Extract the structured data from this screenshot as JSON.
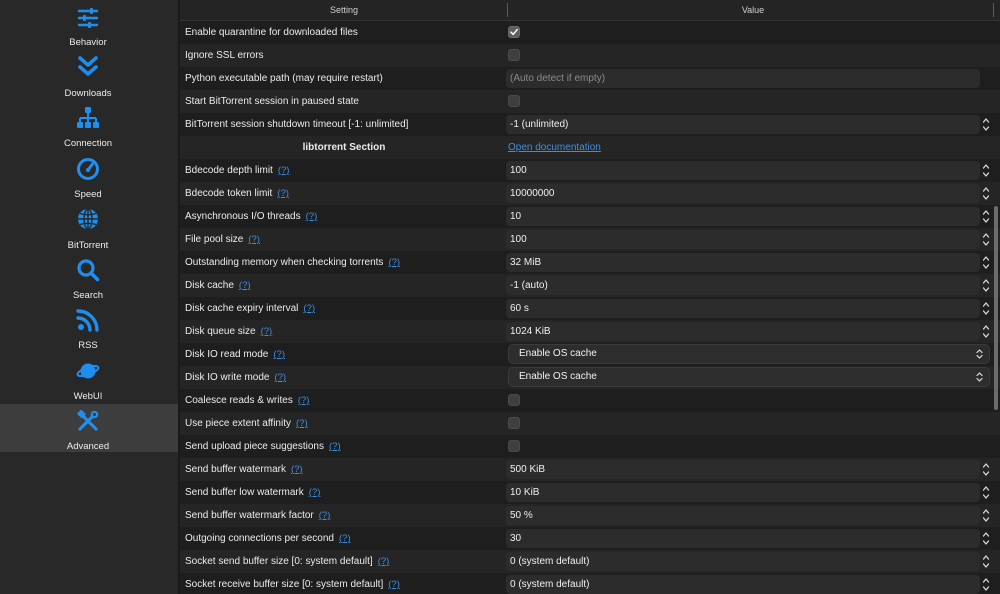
{
  "sidebar": {
    "items": [
      {
        "label": "Behavior",
        "icon": "sliders-icon",
        "active": false
      },
      {
        "label": "Downloads",
        "icon": "double-chevron-down-icon",
        "active": false
      },
      {
        "label": "Connection",
        "icon": "network-icon",
        "active": false
      },
      {
        "label": "Speed",
        "icon": "speedometer-icon",
        "active": false
      },
      {
        "label": "BitTorrent",
        "icon": "globe-icon",
        "active": false
      },
      {
        "label": "Search",
        "icon": "magnifier-icon",
        "active": false
      },
      {
        "label": "RSS",
        "icon": "rss-icon",
        "active": false
      },
      {
        "label": "WebUI",
        "icon": "planet-icon",
        "active": false
      },
      {
        "label": "Advanced",
        "icon": "tools-icon",
        "active": true
      }
    ],
    "accent_color": "#1f8ef1"
  },
  "table": {
    "headers": {
      "setting": "Setting",
      "value": "Value"
    },
    "help_text": "(?)",
    "rows": [
      {
        "label": "Enable quarantine for downloaded files",
        "type": "checkbox",
        "checked": true,
        "help": false
      },
      {
        "label": "Ignore SSL errors",
        "type": "checkbox",
        "checked": false,
        "help": false
      },
      {
        "label": "Python executable path (may require restart)",
        "type": "text",
        "value": "",
        "placeholder": "(Auto detect if empty)",
        "help": false
      },
      {
        "label": "Start BitTorrent session in paused state",
        "type": "checkbox",
        "checked": false,
        "help": false
      },
      {
        "label": "BitTorrent session shutdown timeout [-1: unlimited]",
        "type": "spin",
        "value": "-1 (unlimited)",
        "help": false
      },
      {
        "label": "libtorrent Section",
        "type": "section",
        "link": "Open documentation"
      },
      {
        "label": "Bdecode depth limit",
        "type": "spin",
        "value": "100",
        "help": true
      },
      {
        "label": "Bdecode token limit",
        "type": "spin",
        "value": "10000000",
        "help": true
      },
      {
        "label": "Asynchronous I/O threads",
        "type": "spin",
        "value": "10",
        "help": true
      },
      {
        "label": "File pool size",
        "type": "spin",
        "value": "100",
        "help": true
      },
      {
        "label": "Outstanding memory when checking torrents",
        "type": "spin",
        "value": "32 MiB",
        "help": true
      },
      {
        "label": "Disk cache",
        "type": "spin",
        "value": "-1 (auto)",
        "help": true
      },
      {
        "label": "Disk cache expiry interval",
        "type": "spin",
        "value": "60 s",
        "help": true
      },
      {
        "label": "Disk queue size",
        "type": "spin",
        "value": "1024 KiB",
        "help": true
      },
      {
        "label": "Disk IO read mode",
        "type": "select",
        "value": "Enable OS cache",
        "help": true
      },
      {
        "label": "Disk IO write mode",
        "type": "select",
        "value": "Enable OS cache",
        "help": true
      },
      {
        "label": "Coalesce reads & writes",
        "type": "checkbox",
        "checked": false,
        "help": true
      },
      {
        "label": "Use piece extent affinity",
        "type": "checkbox",
        "checked": false,
        "help": true
      },
      {
        "label": "Send upload piece suggestions",
        "type": "checkbox",
        "checked": false,
        "help": true
      },
      {
        "label": "Send buffer watermark",
        "type": "spin",
        "value": "500 KiB",
        "help": true
      },
      {
        "label": "Send buffer low watermark",
        "type": "spin",
        "value": "10 KiB",
        "help": true
      },
      {
        "label": "Send buffer watermark factor",
        "type": "spin",
        "value": "50 %",
        "help": true
      },
      {
        "label": "Outgoing connections per second",
        "type": "spin",
        "value": "30",
        "help": true
      },
      {
        "label": "Socket send buffer size [0: system default]",
        "type": "spin",
        "value": "0 (system default)",
        "help": true
      },
      {
        "label": "Socket receive buffer size [0: system default]",
        "type": "spin",
        "value": "0 (system default)",
        "help": true
      }
    ]
  }
}
